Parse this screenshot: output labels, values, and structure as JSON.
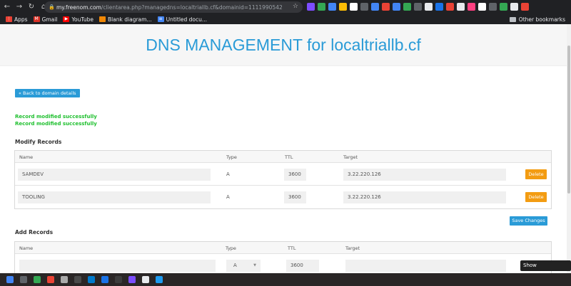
{
  "browser": {
    "url_host": "my.freenom.com",
    "url_path": "/clientarea.php?managedns=localtriallb.cf&domainid=1111990542",
    "bookmarks": [
      {
        "label": "Apps",
        "color": "#e94235"
      },
      {
        "label": "Gmail",
        "color": "#d93025"
      },
      {
        "label": "YouTube",
        "color": "#ff0000"
      },
      {
        "label": "Blank diagram...",
        "color": "#f08705"
      },
      {
        "label": "Untitled docu...",
        "color": "#4285f4"
      }
    ],
    "other_bookmarks": "Other bookmarks",
    "extension_colors": [
      "#7c4dff",
      "#34a853",
      "#4285f4",
      "#fbbc05",
      "#ffffff",
      "#5f6368",
      "#4285f4",
      "#ea4335",
      "#4285f4",
      "#34a853",
      "#5f6368",
      "#e8eaed",
      "#1a73e8",
      "#e94235",
      "#e8eaed",
      "#ff4081",
      "#ffffff",
      "#5f6368",
      "#34a853",
      "#e8eaed",
      "#ea4335"
    ]
  },
  "page": {
    "title": "DNS MANAGEMENT for localtriallb.cf",
    "back_button": "« Back to domain details",
    "messages": [
      "Record modified successfully",
      "Record modified successfully"
    ],
    "modify_section": "Modify Records",
    "add_section": "Add Records",
    "columns": {
      "name": "Name",
      "type": "Type",
      "ttl": "TTL",
      "target": "Target"
    },
    "records": [
      {
        "name": "SAMDEV",
        "type": "A",
        "ttl": "3600",
        "target": "3.22.220.126",
        "delete": "Delete"
      },
      {
        "name": "TOOLING",
        "type": "A",
        "ttl": "3600",
        "target": "3.22.220.126",
        "delete": "Delete"
      }
    ],
    "save_button": "Save Changes",
    "add_row": {
      "name": "",
      "type": "A",
      "ttl": "3600",
      "target": ""
    }
  },
  "taskbar": {
    "tooltip": "Show Applications",
    "icon_colors": [
      "#4285f4",
      "#5f6368",
      "#34a853",
      "#ea4335",
      "#aaaaaa",
      "#4a4a4a",
      "#007acc",
      "#1a73e8",
      "#3c3c3c",
      "#7c4dff",
      "#e8eaed",
      "#1d9bf0"
    ]
  }
}
